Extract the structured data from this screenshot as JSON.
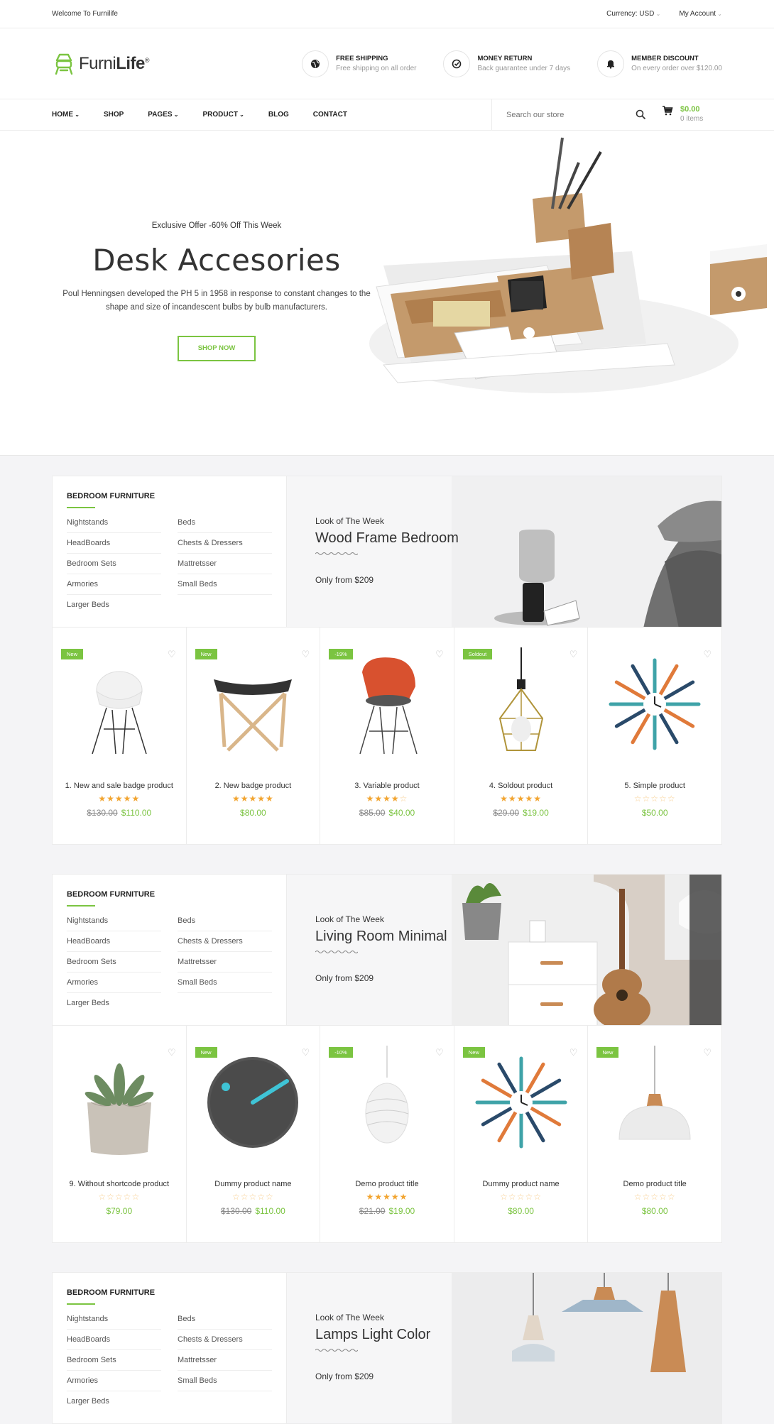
{
  "topbar": {
    "welcome": "Welcome To Furnilife",
    "currency": "Currency: USD",
    "account": "My Account"
  },
  "logo": {
    "text_a": "Furni",
    "text_b": "Life",
    "mark": "®"
  },
  "features": [
    {
      "icon": "globe-icon",
      "title": "FREE SHIPPING",
      "sub": "Free shipping on all order"
    },
    {
      "icon": "check-circle-icon",
      "title": "MONEY RETURN",
      "sub": "Back guarantee under 7 days"
    },
    {
      "icon": "bell-icon",
      "title": "MEMBER DISCOUNT",
      "sub": "On every order over $120.00"
    }
  ],
  "nav": {
    "items": [
      "HOME",
      "SHOP",
      "PAGES",
      "PRODUCT",
      "BLOG",
      "CONTACT"
    ],
    "search_placeholder": "Search our store",
    "cart_amount": "$0.00",
    "cart_items": "0 items"
  },
  "hero": {
    "offer": "Exclusive Offer -60% Off This Week",
    "title": "Desk Accesories",
    "desc": "Poul Henningsen developed the PH 5 in 1958 in response to constant changes to the shape and size of incandescent bulbs by bulb manufacturers.",
    "button": "SHOP NOW"
  },
  "sections": [
    {
      "cat_title": "BEDROOM FURNITURE",
      "cats": [
        "Nightstands",
        "Beds",
        "HeadBoards",
        "Chests & Dressers",
        "Bedroom Sets",
        "Mattretsser",
        "Armories",
        "Small Beds",
        "Larger Beds"
      ],
      "look_kicker": "Look of The Week",
      "look_title": "Wood Frame Bedroom",
      "look_price": "Only from $209",
      "products": [
        {
          "badge": "New",
          "name": "1. New and sale badge product",
          "rating": 5,
          "old": "$130.00",
          "price": "$110.00",
          "img": "chair-white"
        },
        {
          "badge": "New",
          "name": "2. New badge product",
          "rating": 5,
          "old": "",
          "price": "$80.00",
          "img": "stool"
        },
        {
          "badge": "-19%",
          "name": "3. Variable product",
          "rating": 4,
          "old": "$85.00",
          "price": "$40.00",
          "img": "chair-red"
        },
        {
          "badge": "Soldout",
          "name": "4. Soldout product",
          "rating": 5,
          "old": "$29.00",
          "price": "$19.00",
          "img": "cage-lamp"
        },
        {
          "badge": "",
          "name": "5. Simple product",
          "rating": 0,
          "old": "",
          "price": "$50.00",
          "img": "sunburst-clock"
        }
      ]
    },
    {
      "cat_title": "BEDROOM FURNITURE",
      "cats": [
        "Nightstands",
        "Beds",
        "HeadBoards",
        "Chests & Dressers",
        "Bedroom Sets",
        "Mattretsser",
        "Armories",
        "Small Beds",
        "Larger Beds"
      ],
      "look_kicker": "Look of The Week",
      "look_title": "Living Room Minimal",
      "look_price": "Only from $209",
      "products": [
        {
          "badge": "",
          "name": "9. Without shortcode product",
          "rating": 0,
          "old": "",
          "price": "$79.00",
          "img": "succulent"
        },
        {
          "badge": "New",
          "name": "Dummy product name",
          "rating": 0,
          "old": "$130.00",
          "price": "$110.00",
          "img": "wall-clock"
        },
        {
          "badge": "-10%",
          "name": "Demo product title",
          "rating": 5,
          "old": "$21.00",
          "price": "$19.00",
          "img": "pendant-white"
        },
        {
          "badge": "New",
          "name": "Dummy product name",
          "rating": 0,
          "old": "",
          "price": "$80.00",
          "img": "sunburst-clock"
        },
        {
          "badge": "New",
          "name": "Demo product title",
          "rating": 0,
          "old": "",
          "price": "$80.00",
          "img": "dome-lamp"
        }
      ]
    },
    {
      "cat_title": "BEDROOM FURNITURE",
      "cats": [
        "Nightstands",
        "Beds",
        "HeadBoards",
        "Chests & Dressers",
        "Bedroom Sets",
        "Mattretsser",
        "Armories",
        "Small Beds",
        "Larger Beds"
      ],
      "look_kicker": "Look of The Week",
      "look_title": "Lamps Light Color",
      "look_price": "Only from $209",
      "products": []
    }
  ],
  "colors": {
    "accent": "#7bc441",
    "star": "#f2a531",
    "text": "#333333",
    "bg": "#f4f4f6"
  }
}
